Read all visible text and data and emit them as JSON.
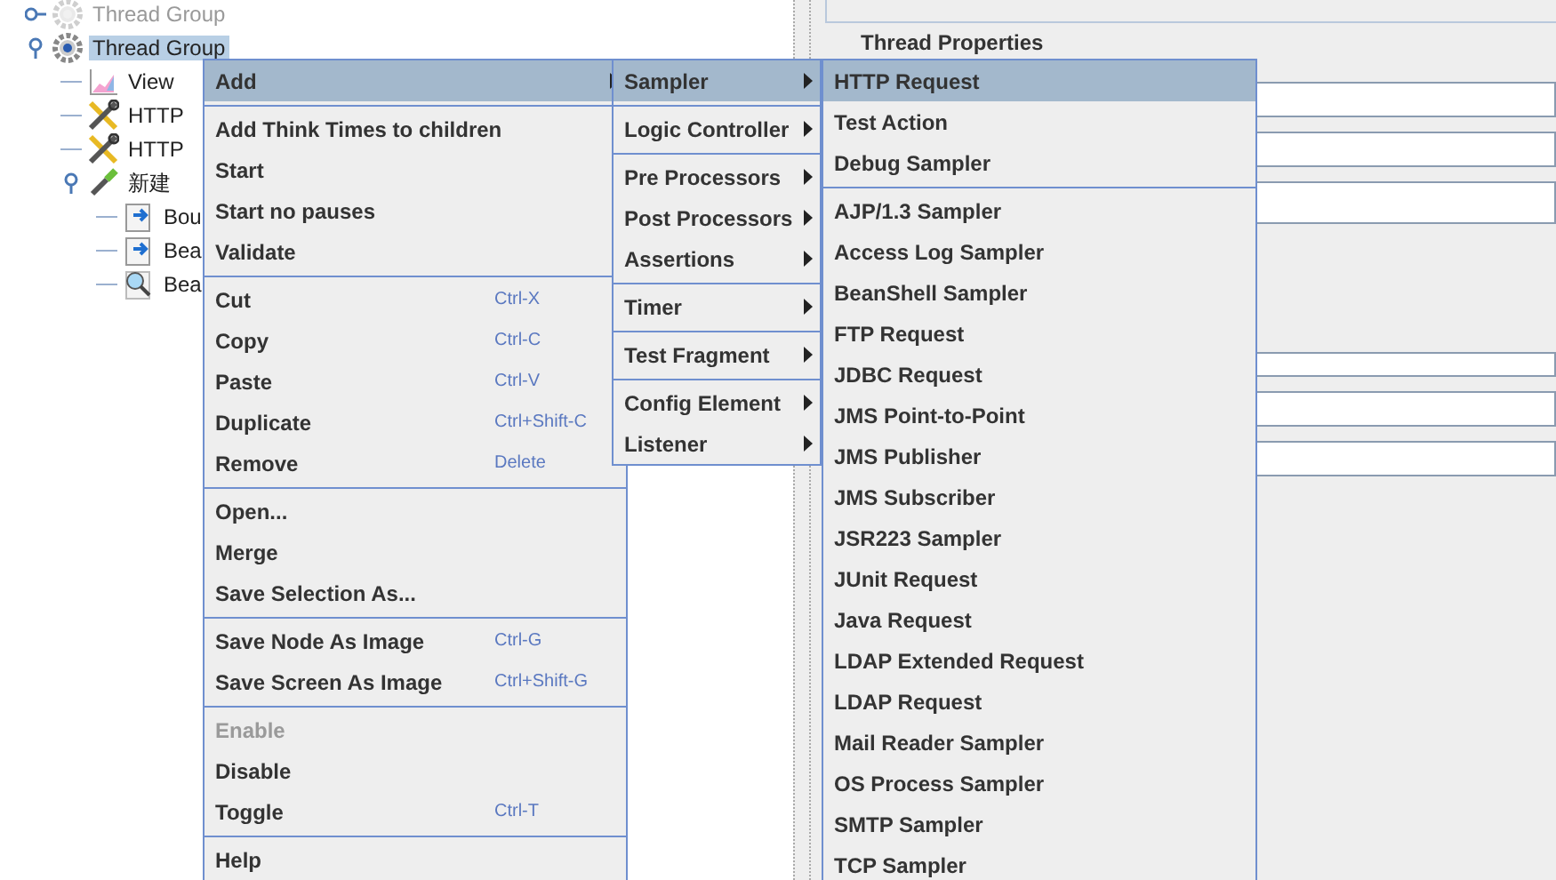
{
  "tree": [
    {
      "label": "Thread Group",
      "kind": "gear",
      "disabled": true,
      "selected": false
    },
    {
      "label": "Thread Group",
      "kind": "gear",
      "disabled": false,
      "selected": true,
      "children": [
        {
          "label": "View",
          "kind": "chart",
          "disabled": false,
          "selected": false
        },
        {
          "label": "HTTP",
          "kind": "tools",
          "disabled": false,
          "selected": false
        },
        {
          "label": "HTTP",
          "kind": "tools",
          "disabled": false,
          "selected": false
        },
        {
          "label": "新建",
          "kind": "dropper",
          "disabled": false,
          "selected": false,
          "children": [
            {
              "label": "Bou",
              "kind": "script",
              "disabled": false,
              "selected": false
            },
            {
              "label": "Bea",
              "kind": "script",
              "disabled": false,
              "selected": false
            },
            {
              "label": "Bea",
              "kind": "magnifier",
              "disabled": false,
              "selected": false
            }
          ]
        }
      ]
    }
  ],
  "panel": {
    "section_title": "Thread Properties"
  },
  "menus": [
    {
      "sections": [
        [
          {
            "label": "Add",
            "selected": true,
            "has_submenu": true,
            "disabled": false
          }
        ],
        [
          {
            "label": "Add Think Times to children",
            "selected": false,
            "has_submenu": false,
            "disabled": false
          },
          {
            "label": "Start",
            "selected": false,
            "has_submenu": false,
            "disabled": false
          },
          {
            "label": "Start no pauses",
            "selected": false,
            "has_submenu": false,
            "disabled": false
          },
          {
            "label": "Validate",
            "selected": false,
            "has_submenu": false,
            "disabled": false
          }
        ],
        [
          {
            "label": "Cut",
            "shortcut": "Ctrl-X",
            "selected": false,
            "has_submenu": false,
            "disabled": false
          },
          {
            "label": "Copy",
            "shortcut": "Ctrl-C",
            "selected": false,
            "has_submenu": false,
            "disabled": false
          },
          {
            "label": "Paste",
            "shortcut": "Ctrl-V",
            "selected": false,
            "has_submenu": false,
            "disabled": false
          },
          {
            "label": "Duplicate",
            "shortcut": "Ctrl+Shift-C",
            "selected": false,
            "has_submenu": false,
            "disabled": false
          },
          {
            "label": "Remove",
            "shortcut": "Delete",
            "selected": false,
            "has_submenu": false,
            "disabled": false
          }
        ],
        [
          {
            "label": "Open...",
            "selected": false,
            "has_submenu": false,
            "disabled": false
          },
          {
            "label": "Merge",
            "selected": false,
            "has_submenu": false,
            "disabled": false
          },
          {
            "label": "Save Selection As...",
            "selected": false,
            "has_submenu": false,
            "disabled": false
          }
        ],
        [
          {
            "label": "Save Node As Image",
            "shortcut": "Ctrl-G",
            "selected": false,
            "has_submenu": false,
            "disabled": false
          },
          {
            "label": "Save Screen As Image",
            "shortcut": "Ctrl+Shift-G",
            "selected": false,
            "has_submenu": false,
            "disabled": false
          }
        ],
        [
          {
            "label": "Enable",
            "selected": false,
            "has_submenu": false,
            "disabled": true
          },
          {
            "label": "Disable",
            "selected": false,
            "has_submenu": false,
            "disabled": false
          },
          {
            "label": "Toggle",
            "shortcut": "Ctrl-T",
            "selected": false,
            "has_submenu": false,
            "disabled": false
          }
        ],
        [
          {
            "label": "Help",
            "selected": false,
            "has_submenu": false,
            "disabled": false
          }
        ]
      ]
    },
    {
      "sections": [
        [
          {
            "label": "Sampler",
            "selected": true,
            "has_submenu": true,
            "disabled": false
          }
        ],
        [
          {
            "label": "Logic Controller",
            "selected": false,
            "has_submenu": true,
            "disabled": false
          }
        ],
        [
          {
            "label": "Pre Processors",
            "selected": false,
            "has_submenu": true,
            "disabled": false
          },
          {
            "label": "Post Processors",
            "selected": false,
            "has_submenu": true,
            "disabled": false
          },
          {
            "label": "Assertions",
            "selected": false,
            "has_submenu": true,
            "disabled": false
          }
        ],
        [
          {
            "label": "Timer",
            "selected": false,
            "has_submenu": true,
            "disabled": false
          }
        ],
        [
          {
            "label": "Test Fragment",
            "selected": false,
            "has_submenu": true,
            "disabled": false
          }
        ],
        [
          {
            "label": "Config Element",
            "selected": false,
            "has_submenu": true,
            "disabled": false
          },
          {
            "label": "Listener",
            "selected": false,
            "has_submenu": true,
            "disabled": false
          }
        ]
      ]
    },
    {
      "sections": [
        [
          {
            "label": "HTTP Request",
            "selected": true,
            "has_submenu": false,
            "disabled": false
          },
          {
            "label": "Test Action",
            "selected": false,
            "has_submenu": false,
            "disabled": false
          },
          {
            "label": "Debug Sampler",
            "selected": false,
            "has_submenu": false,
            "disabled": false
          }
        ],
        [
          {
            "label": "AJP/1.3 Sampler",
            "selected": false,
            "has_submenu": false,
            "disabled": false
          },
          {
            "label": "Access Log Sampler",
            "selected": false,
            "has_submenu": false,
            "disabled": false
          },
          {
            "label": "BeanShell Sampler",
            "selected": false,
            "has_submenu": false,
            "disabled": false
          },
          {
            "label": "FTP Request",
            "selected": false,
            "has_submenu": false,
            "disabled": false
          },
          {
            "label": "JDBC Request",
            "selected": false,
            "has_submenu": false,
            "disabled": false
          },
          {
            "label": "JMS Point-to-Point",
            "selected": false,
            "has_submenu": false,
            "disabled": false
          },
          {
            "label": "JMS Publisher",
            "selected": false,
            "has_submenu": false,
            "disabled": false
          },
          {
            "label": "JMS Subscriber",
            "selected": false,
            "has_submenu": false,
            "disabled": false
          },
          {
            "label": "JSR223 Sampler",
            "selected": false,
            "has_submenu": false,
            "disabled": false
          },
          {
            "label": "JUnit Request",
            "selected": false,
            "has_submenu": false,
            "disabled": false
          },
          {
            "label": "Java Request",
            "selected": false,
            "has_submenu": false,
            "disabled": false
          },
          {
            "label": "LDAP Extended Request",
            "selected": false,
            "has_submenu": false,
            "disabled": false
          },
          {
            "label": "LDAP Request",
            "selected": false,
            "has_submenu": false,
            "disabled": false
          },
          {
            "label": "Mail Reader Sampler",
            "selected": false,
            "has_submenu": false,
            "disabled": false
          },
          {
            "label": "OS Process Sampler",
            "selected": false,
            "has_submenu": false,
            "disabled": false
          },
          {
            "label": "SMTP Sampler",
            "selected": false,
            "has_submenu": false,
            "disabled": false
          },
          {
            "label": "TCP Sampler",
            "selected": false,
            "has_submenu": false,
            "disabled": false
          }
        ]
      ]
    }
  ]
}
